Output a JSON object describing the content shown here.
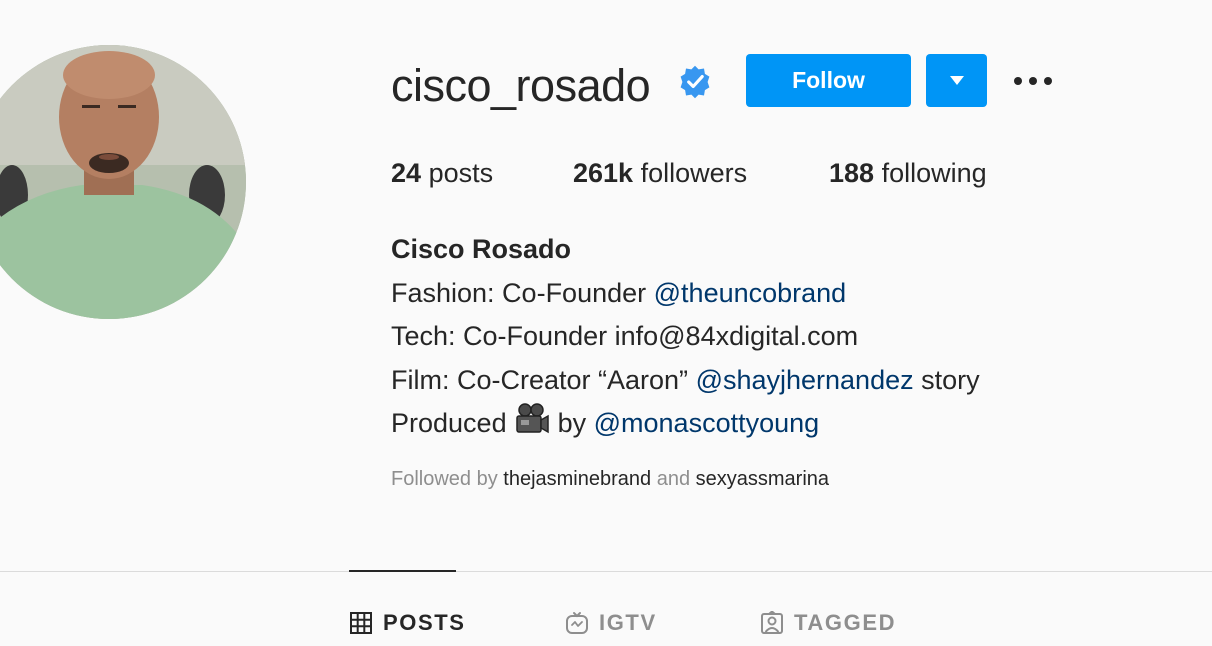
{
  "profile": {
    "username": "cisco_rosado",
    "verified": true,
    "follow_label": "Follow",
    "stats": [
      {
        "count": "24",
        "label": "posts"
      },
      {
        "count": "261k",
        "label": "followers"
      },
      {
        "count": "188",
        "label": "following"
      }
    ],
    "full_name": "Cisco Rosado",
    "bio": {
      "line1_text": "Fashion: Co-Founder ",
      "line1_link": "@theuncobrand",
      "line2_text": "Tech: Co-Founder info@84xdigital.com",
      "line3_text": "Film: Co-Creator “Aaron” ",
      "line3_link": "@shayjhernandez",
      "line3_tail": " story",
      "line4_text": "Produced ",
      "line4_icon": "movie-camera-emoji",
      "line4_mid": " by ",
      "line4_link": "@monascottyoung"
    },
    "followed_by": {
      "prefix": "Followed by ",
      "user1": "thejasminebrand",
      "conjunction": " and ",
      "user2": "sexyassmarina"
    }
  },
  "tabs": [
    {
      "label": "POSTS",
      "icon": "grid-icon",
      "active": true
    },
    {
      "label": "IGTV",
      "icon": "igtv-icon",
      "active": false
    },
    {
      "label": "TAGGED",
      "icon": "tagged-icon",
      "active": false
    }
  ],
  "colors": {
    "accent": "#0095f6",
    "link": "#00376b",
    "verified": "#3897f0",
    "muted": "#8e8e8e"
  }
}
